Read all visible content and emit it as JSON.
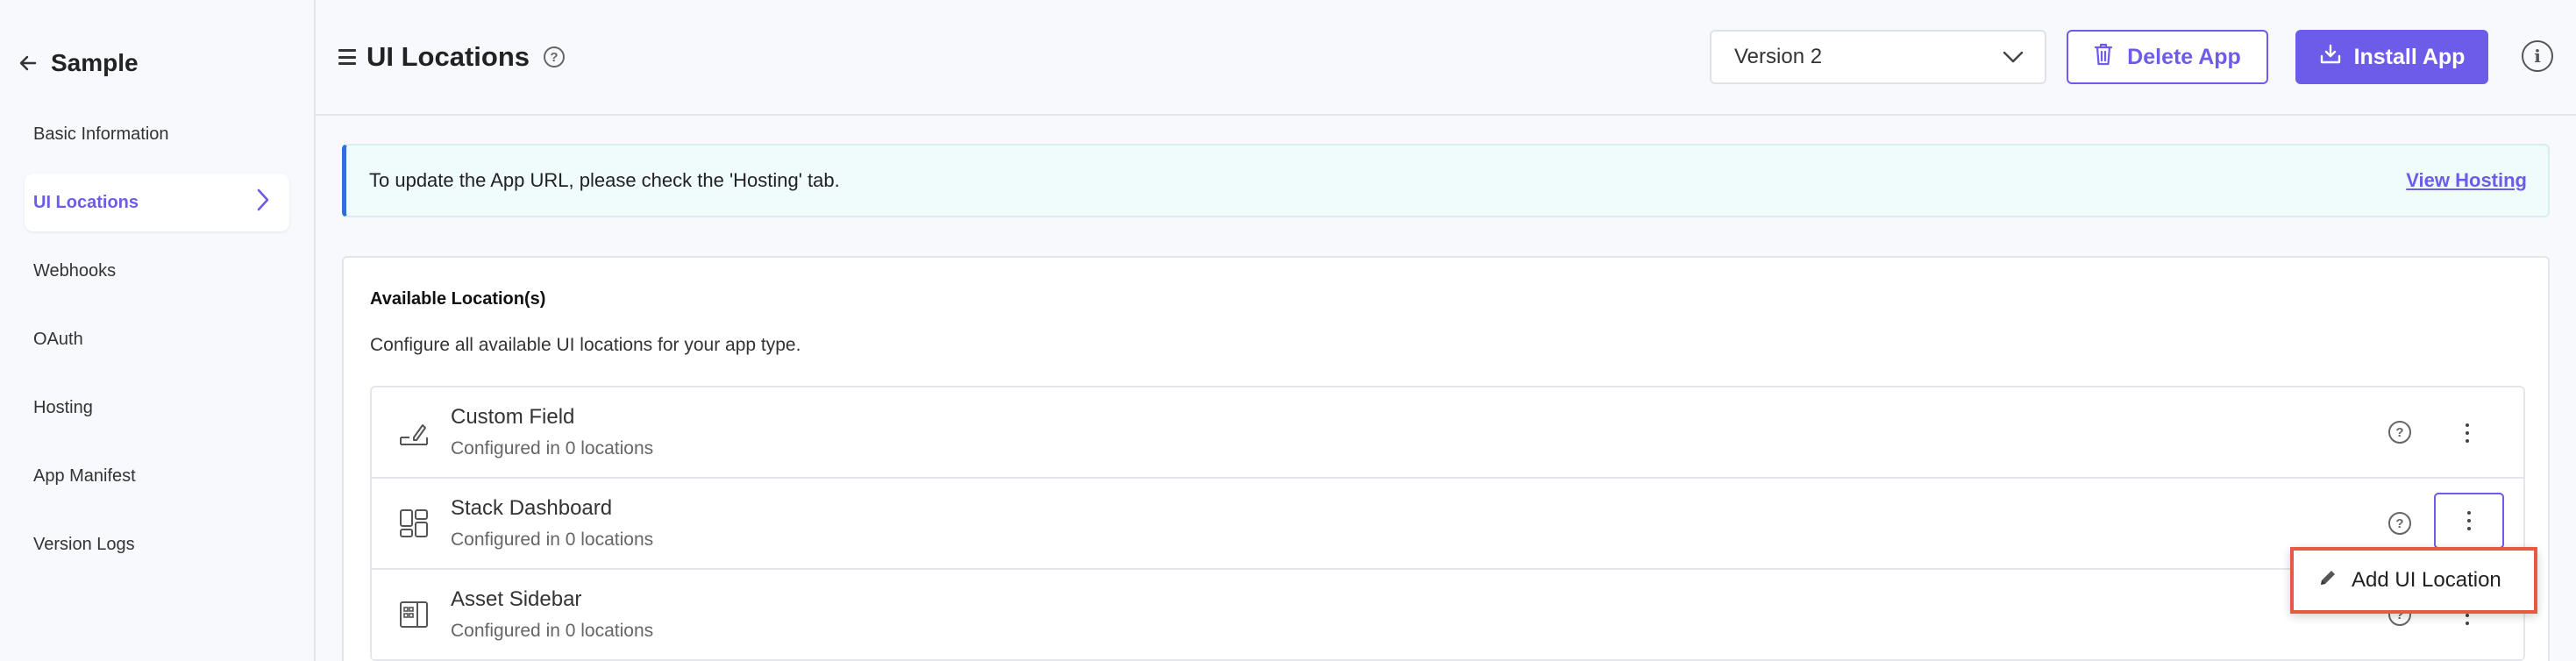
{
  "sidebar": {
    "title": "Sample",
    "items": [
      {
        "label": "Basic Information"
      },
      {
        "label": "UI Locations"
      },
      {
        "label": "Webhooks"
      },
      {
        "label": "OAuth"
      },
      {
        "label": "Hosting"
      },
      {
        "label": "App Manifest"
      },
      {
        "label": "Version Logs"
      }
    ]
  },
  "header": {
    "title": "UI Locations",
    "version_select": "Version 2",
    "delete_label": "Delete App",
    "install_label": "Install App"
  },
  "banner": {
    "text": "To update the App URL, please check the 'Hosting' tab.",
    "link": "View Hosting"
  },
  "card": {
    "title": "Available Location(s)",
    "description": "Configure all available UI locations for your app type.",
    "locations": [
      {
        "name": "Custom Field",
        "status": "Configured in 0 locations",
        "icon": "custom-field-icon"
      },
      {
        "name": "Stack Dashboard",
        "status": "Configured in 0 locations",
        "icon": "dashboard-icon"
      },
      {
        "name": "Asset Sidebar",
        "status": "Configured in 0 locations",
        "icon": "asset-sidebar-icon"
      }
    ]
  },
  "dropdown": {
    "item_label": "Add UI Location"
  },
  "colors": {
    "accent": "#6c5ce7",
    "banner_border": "#2f6fd6",
    "highlight": "#e55a45"
  }
}
